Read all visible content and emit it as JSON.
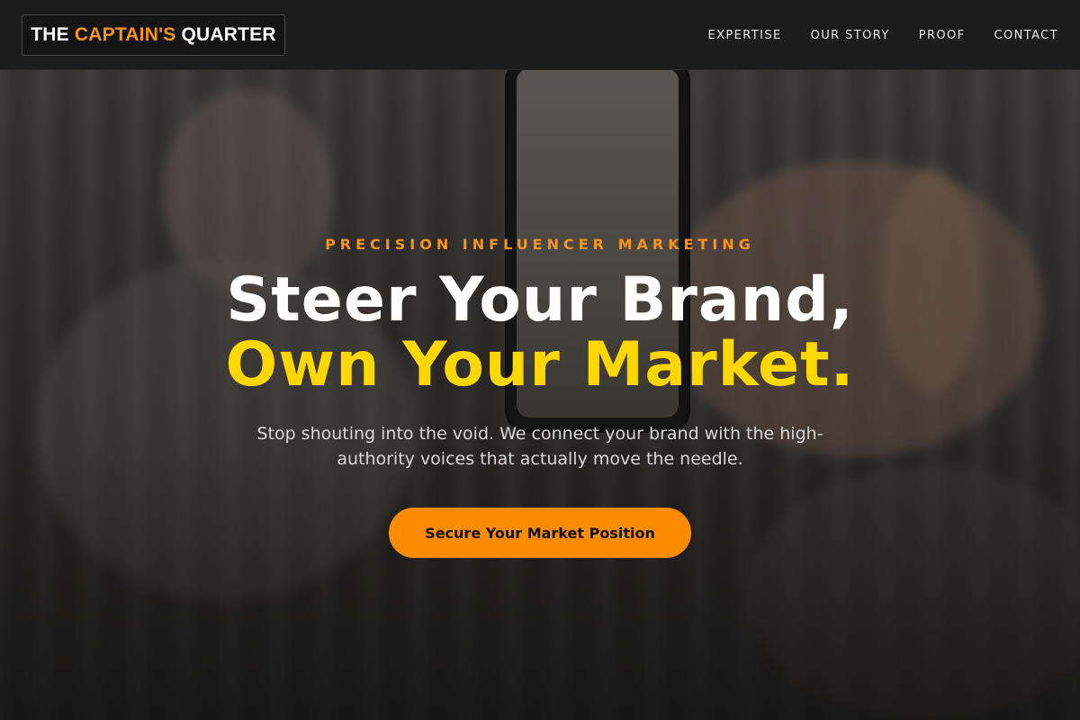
{
  "header": {
    "logo": {
      "part1": "THE",
      "part2": "CAPTAIN'S",
      "part3": "QUARTER"
    },
    "nav": [
      "EXPERTISE",
      "OUR STORY",
      "PROOF",
      "CONTACT"
    ]
  },
  "hero": {
    "eyebrow": "PRECISION INFLUENCER MARKETING",
    "headline_line1": "Steer Your Brand,",
    "headline_line2": "Own Your Market.",
    "subtext": "Stop shouting into the void. We connect your brand with the high-authority voices that actually move the needle.",
    "cta_label": "Secure Your Market Position"
  },
  "colors": {
    "accent_orange": "#f7931e",
    "headline_yellow": "#ffd700",
    "cta_background": "#ff8c00",
    "header_background": "#1c1c1c"
  }
}
